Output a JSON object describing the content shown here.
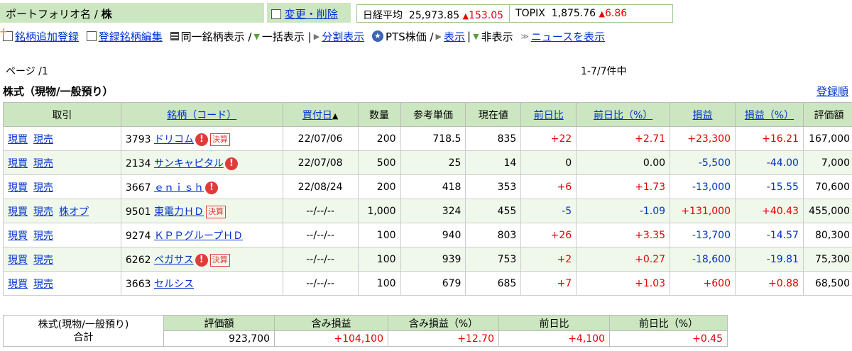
{
  "header": {
    "portfolio_label": "ポートフォリオ名 / ",
    "portfolio_value": "株",
    "edit_link": "変更・削除",
    "indices": [
      {
        "name": "日経平均",
        "value": "25,973.85",
        "change": "153.05"
      },
      {
        "name": "TOPIX",
        "value": "1,875.76",
        "change": "6.86"
      }
    ]
  },
  "toolbar": {
    "add_stock": "銘柄追加登録",
    "edit_stock": "登録銘柄編集",
    "same_stock_display": "同一銘柄表示 /",
    "bulk_display": "一括表示 |",
    "split_display": "分割表示",
    "pts_price": "PTS株価 /",
    "show": "表示",
    "sep": "|",
    "hide": "非表示",
    "show_news": "ニュースを表示"
  },
  "page_info": "ページ /1",
  "count_info": "1-7/7件中",
  "section_title": "株式（現物/一般預り）",
  "sort_link": "登録順",
  "columns": [
    "取引",
    "銘柄（コード）",
    "買付日",
    "数量",
    "参考単価",
    "現在値",
    "前日比",
    "前日比（%）",
    "損益",
    "損益（%）",
    "評価額"
  ],
  "rows": [
    {
      "trade": [
        "現買",
        "現売"
      ],
      "code": "3793",
      "name": "ドリコム",
      "warn": true,
      "kessan": true,
      "date": "22/07/06",
      "qty": "200",
      "unit": "718.5",
      "price": "835",
      "chg": "+22",
      "chg_dir": "up",
      "chgp": "+2.71",
      "chgp_dir": "up",
      "pl": "+23,300",
      "pl_dir": "up",
      "plp": "+16.21",
      "plp_dir": "up",
      "val": "167,000"
    },
    {
      "trade": [
        "現買",
        "現売"
      ],
      "code": "2134",
      "name": "サンキャピタル",
      "warn": true,
      "kessan": false,
      "date": "22/07/08",
      "qty": "500",
      "unit": "25",
      "price": "14",
      "chg": "0",
      "chg_dir": "none",
      "chgp": "0.00",
      "chgp_dir": "none",
      "pl": "-5,500",
      "pl_dir": "dn",
      "plp": "-44.00",
      "plp_dir": "dn",
      "val": "7,000"
    },
    {
      "trade": [
        "現買",
        "現売"
      ],
      "code": "3667",
      "name": "ｅｎｉｓｈ",
      "warn": true,
      "kessan": false,
      "date": "22/08/24",
      "qty": "200",
      "unit": "418",
      "price": "353",
      "chg": "+6",
      "chg_dir": "up",
      "chgp": "+1.73",
      "chgp_dir": "up",
      "pl": "-13,000",
      "pl_dir": "dn",
      "plp": "-15.55",
      "plp_dir": "dn",
      "val": "70,600"
    },
    {
      "trade": [
        "現買",
        "現売",
        "株オプ"
      ],
      "code": "9501",
      "name": "東電力ＨＤ",
      "warn": false,
      "kessan": true,
      "date": "--/--/--",
      "qty": "1,000",
      "unit": "324",
      "price": "455",
      "chg": "-5",
      "chg_dir": "dn",
      "chgp": "-1.09",
      "chgp_dir": "dn",
      "pl": "+131,000",
      "pl_dir": "up",
      "plp": "+40.43",
      "plp_dir": "up",
      "val": "455,000"
    },
    {
      "trade": [
        "現買",
        "現売"
      ],
      "code": "9274",
      "name": "ＫＰＰグループＨＤ",
      "warn": false,
      "kessan": false,
      "date": "--/--/--",
      "qty": "100",
      "unit": "940",
      "price": "803",
      "chg": "+26",
      "chg_dir": "up",
      "chgp": "+3.35",
      "chgp_dir": "up",
      "pl": "-13,700",
      "pl_dir": "dn",
      "plp": "-14.57",
      "plp_dir": "dn",
      "val": "80,300"
    },
    {
      "trade": [
        "現買",
        "現売"
      ],
      "code": "6262",
      "name": "ペガサス",
      "warn": true,
      "kessan": true,
      "date": "--/--/--",
      "qty": "100",
      "unit": "939",
      "price": "753",
      "chg": "+2",
      "chg_dir": "up",
      "chgp": "+0.27",
      "chgp_dir": "up",
      "pl": "-18,600",
      "pl_dir": "dn",
      "plp": "-19.81",
      "plp_dir": "dn",
      "val": "75,300"
    },
    {
      "trade": [
        "現買",
        "現売"
      ],
      "code": "3663",
      "name": "セルシス",
      "warn": false,
      "kessan": false,
      "date": "--/--/--",
      "qty": "100",
      "unit": "679",
      "price": "685",
      "chg": "+7",
      "chg_dir": "up",
      "chgp": "+1.03",
      "chgp_dir": "up",
      "pl": "+600",
      "pl_dir": "up",
      "plp": "+0.88",
      "plp_dir": "up",
      "val": "68,500"
    }
  ],
  "badges": {
    "warn": "!",
    "kessan": "決算"
  },
  "summary": {
    "label_line1": "株式(現物/一般預り)",
    "label_line2": "合計",
    "headers": [
      "評価額",
      "含み損益",
      "含み損益（%）",
      "前日比",
      "前日比（%）"
    ],
    "values": [
      "923,700",
      "+104,100",
      "+12.70",
      "+4,100",
      "+0.45"
    ]
  }
}
